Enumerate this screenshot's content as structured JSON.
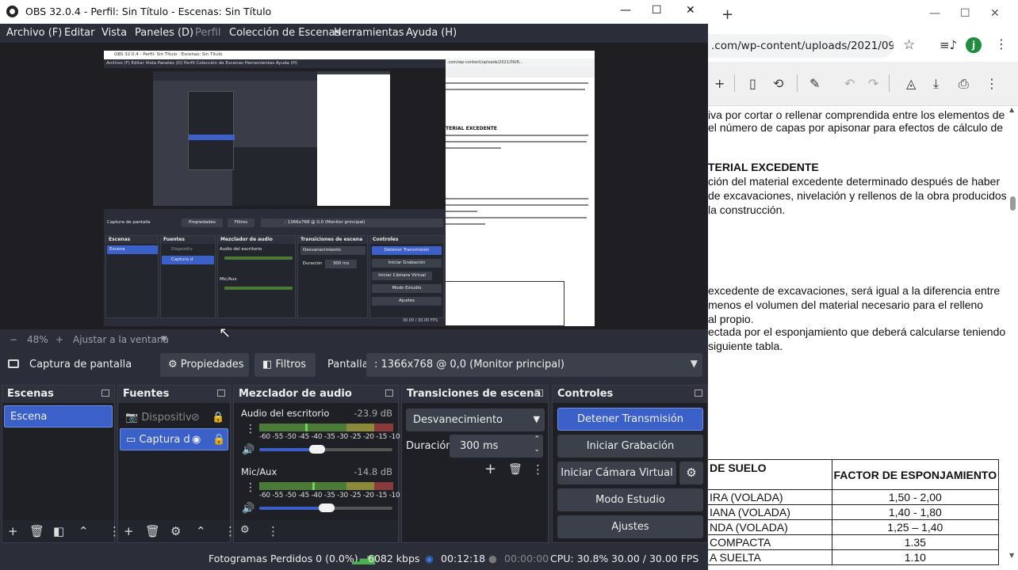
{
  "obs": {
    "window_title": "OBS 32.0.4 - Perfil: Sin Título - Escenas: Sin Título",
    "menu": [
      "Archivo (F)",
      "Editar",
      "Vista",
      "Paneles (D)",
      "Perfil",
      "Colección de Escenas",
      "Herramientas",
      "Ayuda (H)"
    ],
    "zoom": {
      "minus": "−",
      "value": "48%",
      "plus": "+",
      "fit": "Ajustar a la ventana"
    },
    "source_bar": {
      "source_name": "Captura de pantalla",
      "properties": "Propiedades",
      "filters": "Filtros",
      "display_label": "Pantalla",
      "display_value": ": 1366x768 @ 0,0 (Monitor principal)"
    },
    "docks": {
      "scenes": {
        "title": "Escenas",
        "items": [
          "Escena"
        ]
      },
      "sources": {
        "title": "Fuentes",
        "items": [
          "Dispositiv",
          "Captura d"
        ]
      },
      "mixer": {
        "title": "Mezclador de audio",
        "channels": [
          {
            "name": "Audio del escritorio",
            "db": "-23.9 dB",
            "level": 0.62
          },
          {
            "name": "Mic/Aux",
            "db": "-14.8 dB",
            "level": 0.72
          }
        ],
        "scale": "-60 -55 -50 -45 -40 -35 -30 -25 -20 -15 -10 -5 0"
      },
      "transitions": {
        "title": "Transiciones de escena",
        "selected": "Desvanecimiento",
        "duration_label": "Duración",
        "duration_value": "300 ms"
      },
      "controls": {
        "title": "Controles",
        "buttons": [
          "Detener Transmisión",
          "Iniciar Grabación",
          "Iniciar Cámara Virtual",
          "Modo Estudio",
          "Ajustes"
        ]
      }
    },
    "status": {
      "dropped": "Fotogramas Perdidos 0 (0.0%)",
      "bitrate": "6082 kbps",
      "stream_time": "00:12:18",
      "rec_time": "00:00:00",
      "cpu": "CPU: 30.8%",
      "fps": "30.00 / 30.00 FPS"
    }
  },
  "browser": {
    "url": ".com/wp-content/uploads/2021/09/R...",
    "avatar_letter": "j",
    "pdf_lines": [
      "iva por cortar o rellenar comprendida entre los elementos de",
      "el número de capas por apisonar para efectos de cálculo de",
      "TERIAL EXCEDENTE",
      "ción del material excedente determinado después de haber",
      "de excavaciones, nivelación y rellenos de la obra producidos",
      "la construcción.",
      "excedente de excavaciones, será igual a la diferencia entre",
      "menos el volumen del material necesario para el relleno",
      "al propio.",
      "ectada por el esponjamiento que deberá calcularse teniendo",
      "siguiente tabla."
    ],
    "table": {
      "header": [
        "DE SUELO",
        "FACTOR DE ESPONJAMIENTO"
      ],
      "rows": [
        [
          "IRA (VOLADA)",
          "1,50 -  2,00"
        ],
        [
          "IANA (VOLADA)",
          "1,40 -  1,80"
        ],
        [
          "NDA (VOLADA)",
          "1,25 – 1,40"
        ],
        [
          "COMPACTA",
          "1.35"
        ],
        [
          "A SUELTA",
          "1.10"
        ]
      ]
    }
  },
  "nested_preview": {
    "title": "OBS 32.0.4 - Perfil: Sin Título - Escenas: Sin Título",
    "menu": "Archivo (F)   Editar   Vista   Paneles (D)   Perfil   Colección de Escenas   Herramientas   Ayuda (H)"
  }
}
